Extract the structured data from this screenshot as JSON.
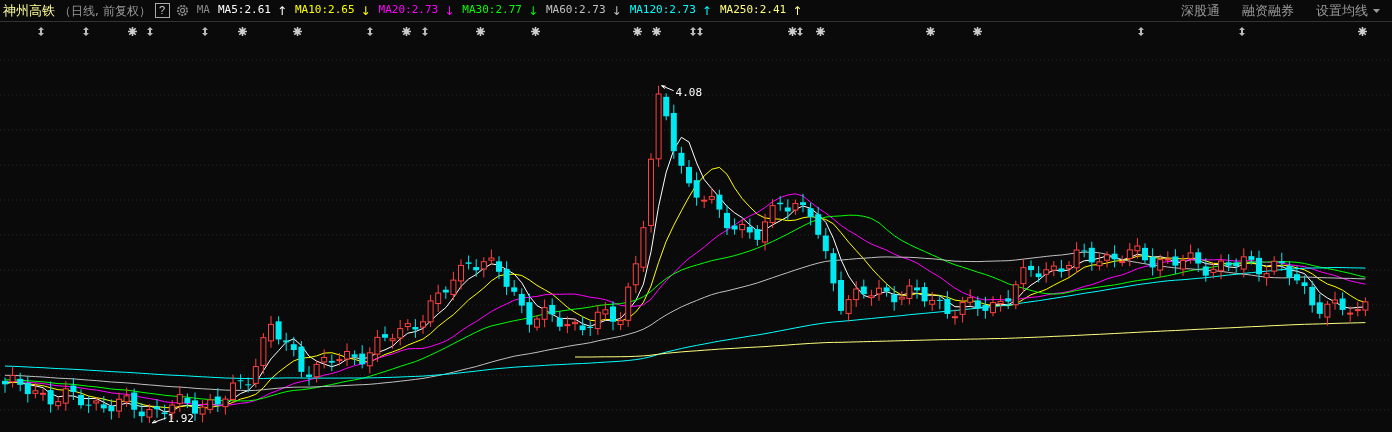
{
  "header": {
    "title": "神州高铁",
    "subtitle": "（日线, 前复权）",
    "help": "?",
    "ma_label": "MA",
    "averages": [
      {
        "label": "MA5:2.61",
        "arrow": "↑",
        "color": "#ffffff"
      },
      {
        "label": "MA10:2.65",
        "arrow": "↓",
        "color": "#ffff00"
      },
      {
        "label": "MA20:2.73",
        "arrow": "↓",
        "color": "#ff00ff"
      },
      {
        "label": "MA30:2.77",
        "arrow": "↓",
        "color": "#00ff00"
      },
      {
        "label": "MA60:2.73",
        "arrow": "↓",
        "color": "#c0c0c0"
      },
      {
        "label": "MA120:2.73",
        "arrow": "↑",
        "color": "#00ffff"
      },
      {
        "label": "MA250:2.41",
        "arrow": "↑",
        "color": "#ffff80"
      }
    ],
    "links": [
      "深股通",
      "融资融券"
    ],
    "settings_menu": "设置均线"
  },
  "chart": {
    "high_label": "4.08",
    "low_label": "1.92"
  }
}
